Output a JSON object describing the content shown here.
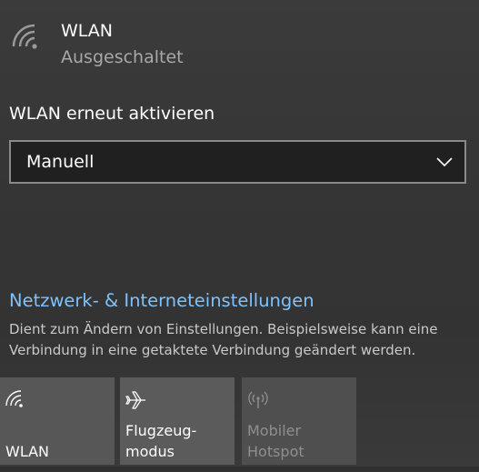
{
  "wifi": {
    "title": "WLAN",
    "status": "Ausgeschaltet",
    "icon": "wifi-icon"
  },
  "reactivate": {
    "label": "WLAN erneut aktivieren",
    "selected": "Manuell"
  },
  "settings": {
    "link": "Netzwerk- & Interneteinstellungen",
    "description": "Dient zum Ändern von Einstellungen. Beispielsweise kann eine Verbindung in eine getaktete Verbindung geändert werden."
  },
  "tiles": [
    {
      "label": "WLAN",
      "icon": "wifi-icon",
      "enabled": true
    },
    {
      "label_line1": "Flugzeug-",
      "label_line2": "modus",
      "icon": "airplane-icon",
      "enabled": true
    },
    {
      "label_line1": "Mobiler",
      "label_line2": "Hotspot",
      "icon": "hotspot-icon",
      "enabled": false
    }
  ],
  "colors": {
    "accent_link": "#7cc2ff",
    "background": "#383838",
    "tile": "#575757",
    "disabled_text": "#8f8f8f"
  }
}
